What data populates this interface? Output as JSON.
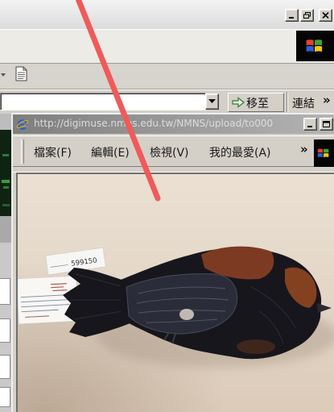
{
  "background_window": {
    "address_bar": {
      "go_label": "移至",
      "links_label": "連結",
      "more_label": "»"
    }
  },
  "popup_window": {
    "url": "http://digimuse.nmns.edu.tw/NMNS/upload/to000",
    "menu": {
      "file": "檔案(F)",
      "edit": "編輯(E)",
      "view": "檢視(V)",
      "favorites": "我的最愛(A)",
      "more": "»"
    },
    "specimen": {
      "tag_number": "599150"
    }
  },
  "icons": {
    "minimize": "minimize-icon",
    "restore": "restore-icon",
    "close": "close-icon",
    "maximize": "maximize-icon",
    "browser": "ie-icon",
    "brand": "windows-logo-icon",
    "document": "document-icon",
    "go": "go-arrow-icon",
    "dropdown": "chevron-down-icon"
  },
  "colors": {
    "annotation_arrow": "#f05a5a",
    "title_bar_inactive": "#8c8c8c",
    "window_face": "#d4d0c8",
    "specimen_plumage": "#17161c",
    "specimen_chestnut": "#7d3a22"
  }
}
